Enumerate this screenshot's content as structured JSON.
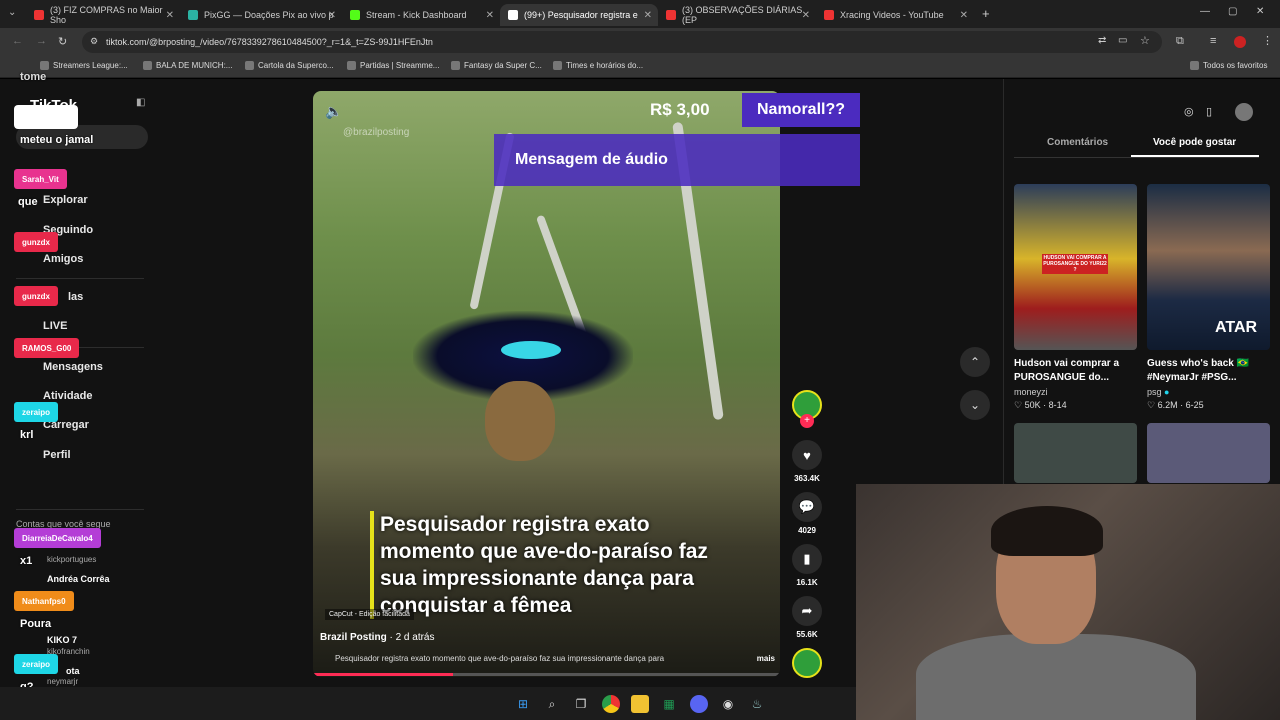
{
  "tabs": [
    {
      "label": "(3) FIZ COMPRAS no Maior Sho",
      "color": "#e33"
    },
    {
      "label": "PixGG — Doações Pix ao vivo p",
      "color": "#2bb3a3"
    },
    {
      "label": "Stream - Kick Dashboard",
      "color": "#53fc18"
    },
    {
      "label": "(99+) Pesquisador registra e",
      "color": "#fff"
    },
    {
      "label": "(3) OBSERVAÇÕES DIÁRIAS (EP",
      "color": "#e33"
    },
    {
      "label": "Xracing Videos - YouTube",
      "color": "#e33"
    }
  ],
  "url": "tiktok.com/@brposting_/video/7678339278610484500?_r=1&_t=ZS-99J1HFEnJtn",
  "bookmarks": [
    "Streamers League:...",
    "BALA DE MUNICH:...",
    "Cartola da Superco...",
    "Partidas | Streamme...",
    "Fantasy da Super C...",
    "Times e horários do..."
  ],
  "bookmarks_all": "Todos os favoritos",
  "sidebar": {
    "logo": "TikTok",
    "nav": [
      "Explorar",
      "Seguindo",
      "Amigos",
      "LIVE",
      "Mensagens",
      "Atividade",
      "Carregar",
      "Perfil"
    ],
    "nav_partial": "las",
    "following_header": "Contas que você segue",
    "accounts": [
      {
        "name": "Andréa Corrêa",
        "handle": ""
      },
      {
        "name": "",
        "handle": "kickportugues"
      },
      {
        "name": "KIKO 7",
        "handle": "kikofranchin"
      },
      {
        "name": "ota",
        "handle": "neymarjr"
      }
    ]
  },
  "chat": [
    {
      "type": "msg",
      "text": "tome"
    },
    {
      "type": "msg",
      "text": "meteu o jamal"
    },
    {
      "type": "pill",
      "text": "Sarah_Vit",
      "color": "#e8338f"
    },
    {
      "type": "msg",
      "text": "que"
    },
    {
      "type": "pill",
      "text": "gunzdx",
      "color": "#e8294a"
    },
    {
      "type": "pill",
      "text": "gunzdx",
      "color": "#e8294a"
    },
    {
      "type": "pill",
      "text": "RAMOS_G00",
      "color": "#e8294a"
    },
    {
      "type": "pill",
      "text": "zeraipo",
      "color": "#1ed6e6"
    },
    {
      "type": "msg",
      "text": "krl"
    },
    {
      "type": "pill",
      "text": "DiarreiaDeCavalo4",
      "color": "#b43dd6"
    },
    {
      "type": "msg",
      "text": "x1"
    },
    {
      "type": "pill",
      "text": "Nathanfps0",
      "color": "#f08c1a"
    },
    {
      "type": "msg",
      "text": "Poura"
    },
    {
      "type": "pill",
      "text": "zeraipo",
      "color": "#1ed6e6"
    },
    {
      "type": "msg",
      "text": "q?"
    }
  ],
  "donation": {
    "amount": "R$ 3,00",
    "name": "Namorall??",
    "message": "Mensagem de áudio"
  },
  "video": {
    "watermark": "@brazilposting",
    "caption": "Pesquisador registra exato momento que ave-do-paraíso faz sua impressionante dança para conquistar a fêmea",
    "capcut": "CapCut - Edição facilitada",
    "author": "Brazil Posting",
    "time": "2 d atrás",
    "description": "Pesquisador registra exato momento que ave-do-paraíso faz sua impressionante dança para",
    "more": "mais",
    "progress": 0.3
  },
  "actions": {
    "likes": "363.4K",
    "comments": "4029",
    "saves": "16.1K",
    "shares": "55.6K"
  },
  "right_panel": {
    "tabs": [
      "Comentários",
      "Você pode gostar"
    ],
    "active_tab": 1,
    "cards": [
      {
        "title": "Hudson vai comprar a PUROSANGUE do...",
        "user": "moneyzi",
        "likes": "50K",
        "date": "8-14",
        "thumb_text": "HUDSON VAI COMPRAR A PUROSANGUE DO YURI22 ?"
      },
      {
        "title": "Guess who's back 🇧🇷 #NeymarJr #PSG...",
        "user": "psg",
        "likes": "6.2M",
        "date": "6-25",
        "thumb_text": "ATAR"
      }
    ]
  }
}
